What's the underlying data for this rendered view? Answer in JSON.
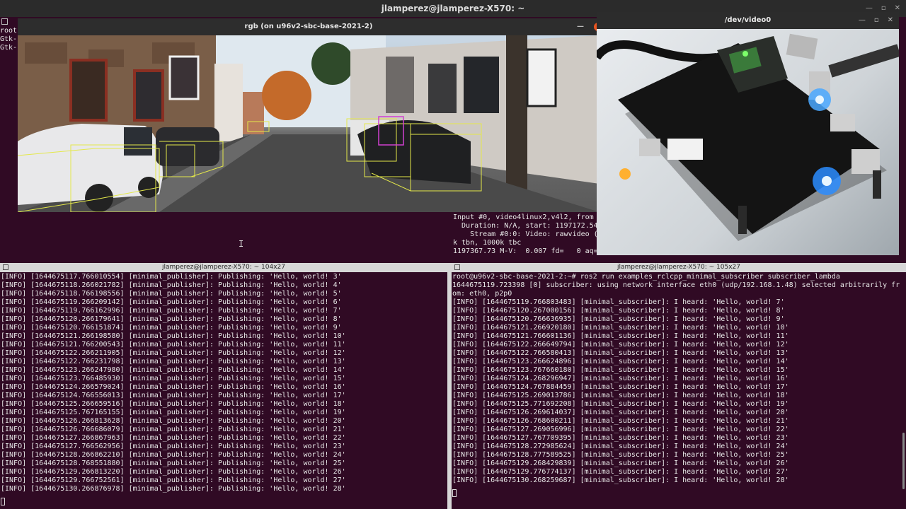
{
  "main_window": {
    "title": "jlamperez@jlamperez-X570: ~"
  },
  "bg_terminal": {
    "lines": [
      "root",
      "Gtk-",
      "Gtk-"
    ]
  },
  "rgb_window": {
    "title": "rgb (on u96v2-sbc-base-2021-2)"
  },
  "ffmpeg_terminal": {
    "lines": [
      "Input #0, video4linux2,v4l2, from",
      "  Duration: N/A, start: 1197172.54",
      "    Stream #0:0: Video: rawvideo (",
      "k tbn, 1000k tbc",
      "1197367.73 M-V:  0.007 fd=   0 aq="
    ]
  },
  "cam_window": {
    "title": "/dev/video0"
  },
  "left_terminal": {
    "title": "jlamperez@jlamperez-X570: ~ 104x27",
    "lines": [
      "[INFO] [1644675117.766010554] [minimal_publisher]: Publishing: 'Hello, world! 3'",
      "[INFO] [1644675118.266021782] [minimal_publisher]: Publishing: 'Hello, world! 4'",
      "[INFO] [1644675118.766198556] [minimal_publisher]: Publishing: 'Hello, world! 5'",
      "[INFO] [1644675119.266209142] [minimal_publisher]: Publishing: 'Hello, world! 6'",
      "[INFO] [1644675119.766162996] [minimal_publisher]: Publishing: 'Hello, world! 7'",
      "[INFO] [1644675120.266179641] [minimal_publisher]: Publishing: 'Hello, world! 8'",
      "[INFO] [1644675120.766151874] [minimal_publisher]: Publishing: 'Hello, world! 9'",
      "[INFO] [1644675121.266198580] [minimal_publisher]: Publishing: 'Hello, world! 10'",
      "[INFO] [1644675121.766200543] [minimal_publisher]: Publishing: 'Hello, world! 11'",
      "[INFO] [1644675122.266211905] [minimal_publisher]: Publishing: 'Hello, world! 12'",
      "[INFO] [1644675122.766231798] [minimal_publisher]: Publishing: 'Hello, world! 13'",
      "[INFO] [1644675123.266247980] [minimal_publisher]: Publishing: 'Hello, world! 14'",
      "[INFO] [1644675123.766485930] [minimal_publisher]: Publishing: 'Hello, world! 15'",
      "[INFO] [1644675124.266579024] [minimal_publisher]: Publishing: 'Hello, world! 16'",
      "[INFO] [1644675124.766556013] [minimal_publisher]: Publishing: 'Hello, world! 17'",
      "[INFO] [1644675125.266659516] [minimal_publisher]: Publishing: 'Hello, world! 18'",
      "[INFO] [1644675125.767165155] [minimal_publisher]: Publishing: 'Hello, world! 19'",
      "[INFO] [1644675126.266813628] [minimal_publisher]: Publishing: 'Hello, world! 20'",
      "[INFO] [1644675126.766686079] [minimal_publisher]: Publishing: 'Hello, world! 21'",
      "[INFO] [1644675127.266867963] [minimal_publisher]: Publishing: 'Hello, world! 22'",
      "[INFO] [1644675127.766562956] [minimal_publisher]: Publishing: 'Hello, world! 23'",
      "[INFO] [1644675128.266862210] [minimal_publisher]: Publishing: 'Hello, world! 24'",
      "[INFO] [1644675128.768551880] [minimal_publisher]: Publishing: 'Hello, world! 25'",
      "[INFO] [1644675129.266813220] [minimal_publisher]: Publishing: 'Hello, world! 26'",
      "[INFO] [1644675129.766752561] [minimal_publisher]: Publishing: 'Hello, world! 27'",
      "[INFO] [1644675130.266876978] [minimal_publisher]: Publishing: 'Hello, world! 28'"
    ]
  },
  "right_terminal": {
    "title": "jlamperez@jlamperez-X570: ~ 105x27",
    "lines": [
      "root@u96v2-sbc-base-2021-2:~# ros2 run examples_rclcpp_minimal_subscriber subscriber_lambda",
      "1644675119.723398 [0] subscriber: using network interface eth0 (udp/192.168.1.48) selected arbitrarily fr",
      "om: eth0, p2p0",
      "[INFO] [1644675119.766803483] [minimal_subscriber]: I heard: 'Hello, world! 7'",
      "[INFO] [1644675120.267000156] [minimal_subscriber]: I heard: 'Hello, world! 8'",
      "[INFO] [1644675120.766636935] [minimal_subscriber]: I heard: 'Hello, world! 9'",
      "[INFO] [1644675121.266920180] [minimal_subscriber]: I heard: 'Hello, world! 10'",
      "[INFO] [1644675121.766601136] [minimal_subscriber]: I heard: 'Hello, world! 11'",
      "[INFO] [1644675122.266649794] [minimal_subscriber]: I heard: 'Hello, world! 12'",
      "[INFO] [1644675122.766580413] [minimal_subscriber]: I heard: 'Hello, world! 13'",
      "[INFO] [1644675123.266624896] [minimal_subscriber]: I heard: 'Hello, world! 14'",
      "[INFO] [1644675123.767660180] [minimal_subscriber]: I heard: 'Hello, world! 15'",
      "[INFO] [1644675124.268296947] [minimal_subscriber]: I heard: 'Hello, world! 16'",
      "[INFO] [1644675124.767884459] [minimal_subscriber]: I heard: 'Hello, world! 17'",
      "[INFO] [1644675125.269013786] [minimal_subscriber]: I heard: 'Hello, world! 18'",
      "[INFO] [1644675125.771692208] [minimal_subscriber]: I heard: 'Hello, world! 19'",
      "[INFO] [1644675126.269614037] [minimal_subscriber]: I heard: 'Hello, world! 20'",
      "[INFO] [1644675126.768600211] [minimal_subscriber]: I heard: 'Hello, world! 21'",
      "[INFO] [1644675127.269056996] [minimal_subscriber]: I heard: 'Hello, world! 22'",
      "[INFO] [1644675127.767709395] [minimal_subscriber]: I heard: 'Hello, world! 23'",
      "[INFO] [1644675128.272985624] [minimal_subscriber]: I heard: 'Hello, world! 24'",
      "[INFO] [1644675128.777589525] [minimal_subscriber]: I heard: 'Hello, world! 25'",
      "[INFO] [1644675129.268429839] [minimal_subscriber]: I heard: 'Hello, world! 26'",
      "[INFO] [1644675129.776774137] [minimal_subscriber]: I heard: 'Hello, world! 27'",
      "[INFO] [1644675130.268259687] [minimal_subscriber]: I heard: 'Hello, world! 28'"
    ]
  }
}
